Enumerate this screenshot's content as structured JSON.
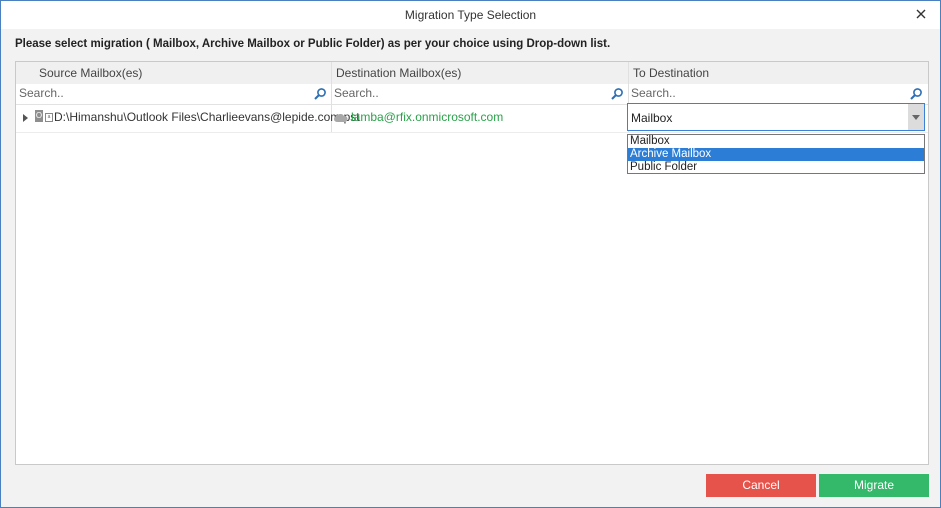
{
  "window": {
    "title": "Migration Type Selection"
  },
  "instruction": "Please select migration ( Mailbox, Archive Mailbox or Public Folder) as per your choice using Drop-down list.",
  "columns": [
    {
      "label": "Source Mailbox(es)",
      "search_placeholder": "Search.."
    },
    {
      "label": "Destination Mailbox(es)",
      "search_placeholder": "Search.."
    },
    {
      "label": "To Destination",
      "search_placeholder": "Search.."
    }
  ],
  "rows": [
    {
      "source": "D:\\Himanshu\\Outlook Files\\Charlieevans@lepide.com.pst",
      "destination": "lamba@rfix.onmicrosoft.com",
      "to_destination": "Mailbox"
    }
  ],
  "dropdown": {
    "options": [
      "Mailbox",
      "Archive Mailbox",
      "Public Folder"
    ],
    "highlighted": "Archive Mailbox"
  },
  "buttons": {
    "cancel": "Cancel",
    "migrate": "Migrate"
  },
  "colors": {
    "cancel": "#e5534b",
    "migrate": "#34b86a",
    "destination_text": "#2aa24a",
    "highlight": "#2b7dd6"
  },
  "icons": {
    "close": "close-icon",
    "search": "search-icon",
    "expand": "expand-arrow-icon",
    "pst": "pst-file-icon",
    "cloud": "cloud-icon",
    "dropdown": "chevron-down-icon"
  }
}
